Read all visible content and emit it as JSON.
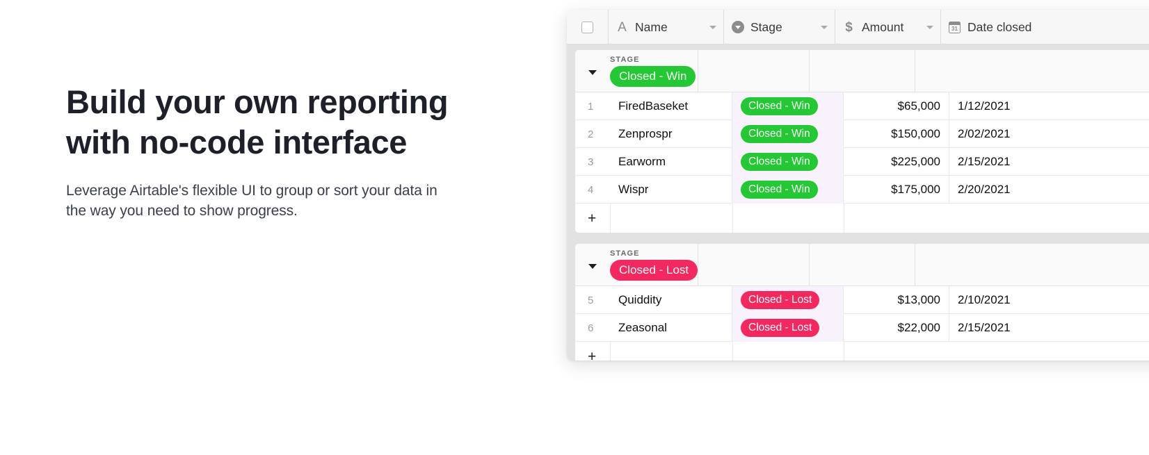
{
  "hero": {
    "headline": "Build your own reporting with no-code interface",
    "subcopy": "Leverage Airtable's flexible UI to group or sort your data in the way you need to show progress."
  },
  "table": {
    "select_all_checkbox": "unchecked",
    "columns": [
      {
        "label": "Name",
        "icon": "text-field-icon",
        "icon_glyph": "A",
        "has_caret": true
      },
      {
        "label": "Stage",
        "icon": "single-select-icon",
        "icon_glyph": "circle-chevron",
        "has_caret": true
      },
      {
        "label": "Amount",
        "icon": "currency-icon",
        "icon_glyph": "$",
        "has_caret": true
      },
      {
        "label": "Date closed",
        "icon": "calendar-icon",
        "icon_glyph": "31",
        "has_caret": false
      }
    ],
    "group_field_label": "STAGE",
    "add_row_label": "+",
    "groups": [
      {
        "value": "Closed - Win",
        "color": "#22c932",
        "collapsed": false,
        "rows": [
          {
            "num": "1",
            "name": "FiredBaseket",
            "stage": "Closed - Win",
            "amount": "$65,000",
            "date": "1/12/2021"
          },
          {
            "num": "2",
            "name": "Zenprospr",
            "stage": "Closed - Win",
            "amount": "$150,000",
            "date": "2/02/2021"
          },
          {
            "num": "3",
            "name": "Earworm",
            "stage": "Closed - Win",
            "amount": "$225,000",
            "date": "2/15/2021"
          },
          {
            "num": "4",
            "name": "Wispr",
            "stage": "Closed - Win",
            "amount": "$175,000",
            "date": "2/20/2021"
          }
        ]
      },
      {
        "value": "Closed - Lost",
        "color": "#f4285e",
        "collapsed": false,
        "rows": [
          {
            "num": "5",
            "name": "Quiddity",
            "stage": "Closed - Lost",
            "amount": "$13,000",
            "date": "2/10/2021"
          },
          {
            "num": "6",
            "name": "Zeasonal",
            "stage": "Closed - Lost",
            "amount": "$22,000",
            "date": "2/15/2021"
          }
        ]
      }
    ]
  }
}
